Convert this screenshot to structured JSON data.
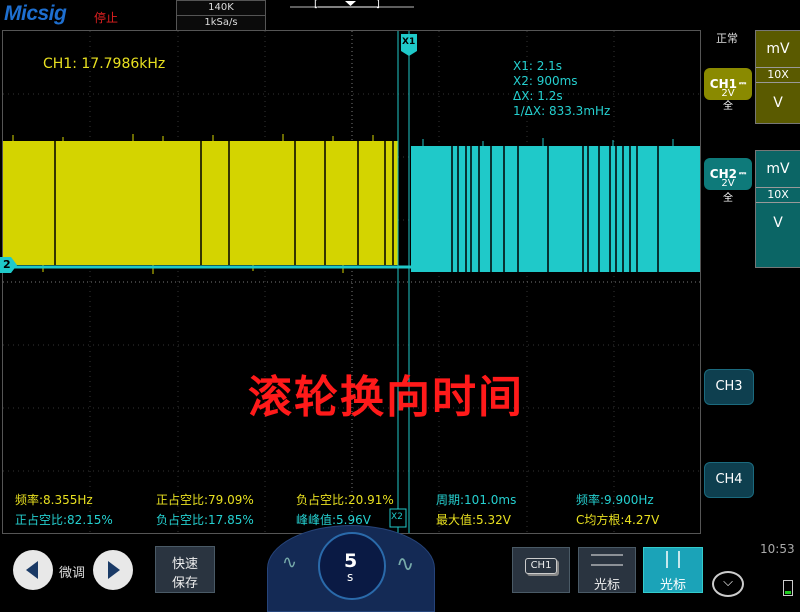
{
  "header": {
    "brand": "Micsig",
    "state": "停止",
    "memory_depth": "140K",
    "sample_rate": "1kSa/s",
    "trigger_bracket_left": "[",
    "trigger_bracket_right": "]"
  },
  "screen": {
    "frequency_readout": "CH1: 17.7986kHz",
    "cursor_marker_x1": "X1",
    "cursor_marker_x2": "X2",
    "channel_marker": "2",
    "cursors": {
      "x1": "X1:  2.1s",
      "x2": "X2:  900ms",
      "dx": "ΔX:  1.2s",
      "inv_dx": "1/ΔX:  833.3mHz"
    },
    "overlay_title": "滚轮换向时间",
    "measurements": {
      "row1": [
        "频率:8.355Hz",
        "正占空比:79.09%",
        "负占空比:20.91%",
        "周期:101.0ms",
        "频率:9.900Hz"
      ],
      "row2": [
        "正占空比:82.15%",
        "负占空比:17.85%",
        "峰峰值:5.96V",
        "最大值:5.32V",
        "C均方根:4.27V"
      ]
    },
    "ch1_color": "#d4d400",
    "ch2_color": "#1fc9c9"
  },
  "right_panel": {
    "mode": "正常",
    "ch1": {
      "label": "CH1",
      "scale": "2V",
      "coupling": "全",
      "color": "#8a8a00"
    },
    "ch2": {
      "label": "CH2",
      "scale": "2V",
      "coupling": "全",
      "color": "#0e7a7a"
    },
    "ch1_panel": {
      "unit": "mV",
      "probe": "10X",
      "unit2": "V"
    },
    "ch2_panel": {
      "unit": "mV",
      "probe": "10X",
      "unit2": "V"
    },
    "ch3_label": "CH3",
    "ch4_label": "CH4"
  },
  "bottom": {
    "fine_label": "微调",
    "quick_save_line1": "快速",
    "quick_save_line2": "保存",
    "timebase_value": "5",
    "timebase_unit": "s",
    "ch1_chip": "CH1",
    "cursor_label1": "光标",
    "cursor_label2": "光标",
    "clock": "10:53"
  }
}
